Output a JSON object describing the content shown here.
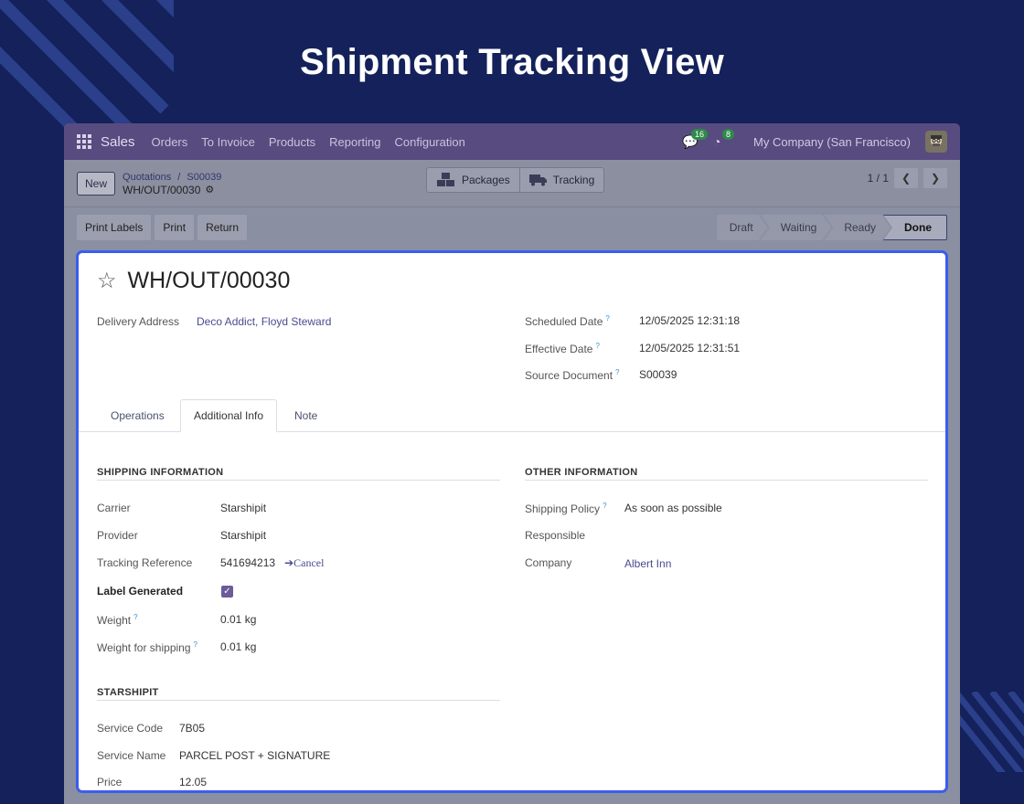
{
  "hero": {
    "title": "Shipment Tracking View"
  },
  "navbar": {
    "brand": "Sales",
    "menu": [
      "Orders",
      "To Invoice",
      "Products",
      "Reporting",
      "Configuration"
    ],
    "messages_count": "16",
    "activities_count": "8",
    "company": "My Company (San Francisco)"
  },
  "control_panel": {
    "new_label": "New",
    "breadcrumb_parent": "Quotations",
    "breadcrumb_sep": "/",
    "breadcrumb_mid": "S00039",
    "breadcrumb_current": "WH/OUT/00030",
    "packages_label": "Packages",
    "tracking_label": "Tracking",
    "pager": "1 / 1"
  },
  "actions": {
    "print_labels": "Print Labels",
    "print": "Print",
    "return": "Return"
  },
  "statusbar": [
    "Draft",
    "Waiting",
    "Ready",
    "Done"
  ],
  "record": {
    "name": "WH/OUT/00030",
    "delivery_address_label": "Delivery Address",
    "delivery_address": "Deco Addict, Floyd Steward",
    "scheduled_date_label": "Scheduled Date",
    "scheduled_date": "12/05/2025 12:31:18",
    "effective_date_label": "Effective Date",
    "effective_date": "12/05/2025 12:31:51",
    "source_document_label": "Source Document",
    "source_document": "S00039",
    "tip": "?"
  },
  "tabs": [
    "Operations",
    "Additional Info",
    "Note"
  ],
  "shipping": {
    "header": "SHIPPING INFORMATION",
    "carrier_label": "Carrier",
    "carrier": "Starshipit",
    "provider_label": "Provider",
    "provider": "Starshipit",
    "tracking_label": "Tracking Reference",
    "tracking": "541694213",
    "cancel": "➔Cancel",
    "label_generated_label": "Label Generated",
    "label_generated": true,
    "weight_label": "Weight",
    "weight": "0.01 kg",
    "weight_shipping_label": "Weight for shipping",
    "weight_shipping": "0.01 kg"
  },
  "other": {
    "header": "OTHER INFORMATION",
    "policy_label": "Shipping Policy",
    "policy": "As soon as possible",
    "responsible_label": "Responsible",
    "company_label": "Company",
    "company": "Albert Inn"
  },
  "starshipit": {
    "header": "STARSHIPIT",
    "service_code_label": "Service Code",
    "service_code": "7B05",
    "service_name_label": "Service Name",
    "service_name": "PARCEL POST + SIGNATURE",
    "price_label": "Price",
    "price": "12.05"
  }
}
